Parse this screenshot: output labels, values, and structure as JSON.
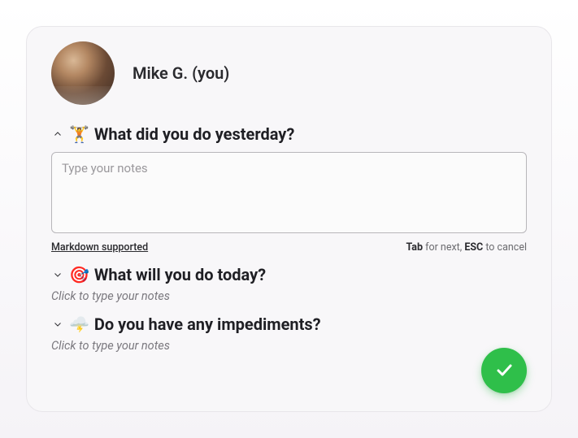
{
  "user": {
    "display_name": "Mike G. (you)"
  },
  "questions": [
    {
      "emoji": "🏋️",
      "text": "What did you do yesterday?",
      "expanded": true,
      "placeholder": "Type your notes",
      "value": "",
      "collapsed_hint": "Click to type your notes"
    },
    {
      "emoji": "🎯",
      "text": "What will you do today?",
      "expanded": false,
      "placeholder": "Type your notes",
      "value": "",
      "collapsed_hint": "Click to type your notes"
    },
    {
      "emoji": "🌩️",
      "text": "Do you have any impediments?",
      "expanded": false,
      "placeholder": "Type your notes",
      "value": "",
      "collapsed_hint": "Click to type your notes"
    }
  ],
  "hints": {
    "markdown_label": "Markdown supported",
    "tab_key": "Tab",
    "tab_text": " for next, ",
    "esc_key": "ESC",
    "esc_text": " to cancel"
  }
}
